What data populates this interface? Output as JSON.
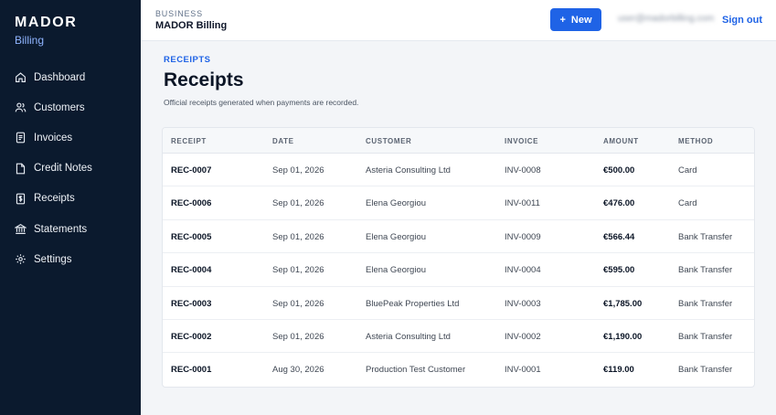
{
  "sidebar": {
    "brand_name": "MADOR",
    "brand_sub": "Billing",
    "items": [
      {
        "label": "Dashboard",
        "icon": "home-icon"
      },
      {
        "label": "Customers",
        "icon": "users-icon"
      },
      {
        "label": "Invoices",
        "icon": "document-icon"
      },
      {
        "label": "Credit Notes",
        "icon": "file-icon"
      },
      {
        "label": "Receipts",
        "icon": "receipt-icon"
      },
      {
        "label": "Statements",
        "icon": "bank-icon"
      },
      {
        "label": "Settings",
        "icon": "gear-icon"
      }
    ]
  },
  "header": {
    "business_label": "BUSINESS",
    "business_name": "MADOR Billing",
    "new_button": "New",
    "user_email": "user@madorbilling.com",
    "signout": "Sign out"
  },
  "page": {
    "eyebrow": "RECEIPTS",
    "title": "Receipts",
    "description": "Official receipts generated when payments are recorded."
  },
  "table": {
    "columns": [
      "RECEIPT",
      "DATE",
      "CUSTOMER",
      "INVOICE",
      "AMOUNT",
      "METHOD"
    ],
    "rows": [
      {
        "receipt": "REC-0007",
        "date": "Sep 01, 2026",
        "customer": "Asteria Consulting Ltd",
        "invoice": "INV-0008",
        "amount": "€500.00",
        "method": "Card"
      },
      {
        "receipt": "REC-0006",
        "date": "Sep 01, 2026",
        "customer": "Elena Georgiou",
        "invoice": "INV-0011",
        "amount": "€476.00",
        "method": "Card"
      },
      {
        "receipt": "REC-0005",
        "date": "Sep 01, 2026",
        "customer": "Elena Georgiou",
        "invoice": "INV-0009",
        "amount": "€566.44",
        "method": "Bank Transfer"
      },
      {
        "receipt": "REC-0004",
        "date": "Sep 01, 2026",
        "customer": "Elena Georgiou",
        "invoice": "INV-0004",
        "amount": "€595.00",
        "method": "Bank Transfer"
      },
      {
        "receipt": "REC-0003",
        "date": "Sep 01, 2026",
        "customer": "BluePeak Properties Ltd",
        "invoice": "INV-0003",
        "amount": "€1,785.00",
        "method": "Bank Transfer"
      },
      {
        "receipt": "REC-0002",
        "date": "Sep 01, 2026",
        "customer": "Asteria Consulting Ltd",
        "invoice": "INV-0002",
        "amount": "€1,190.00",
        "method": "Bank Transfer"
      },
      {
        "receipt": "REC-0001",
        "date": "Aug 30, 2026",
        "customer": "Production Test Customer",
        "invoice": "INV-0001",
        "amount": "€119.00",
        "method": "Bank Transfer"
      }
    ]
  },
  "colors": {
    "sidebar_bg": "#0b1a2e",
    "accent": "#1f63e6",
    "page_bg": "#f3f5f8"
  }
}
